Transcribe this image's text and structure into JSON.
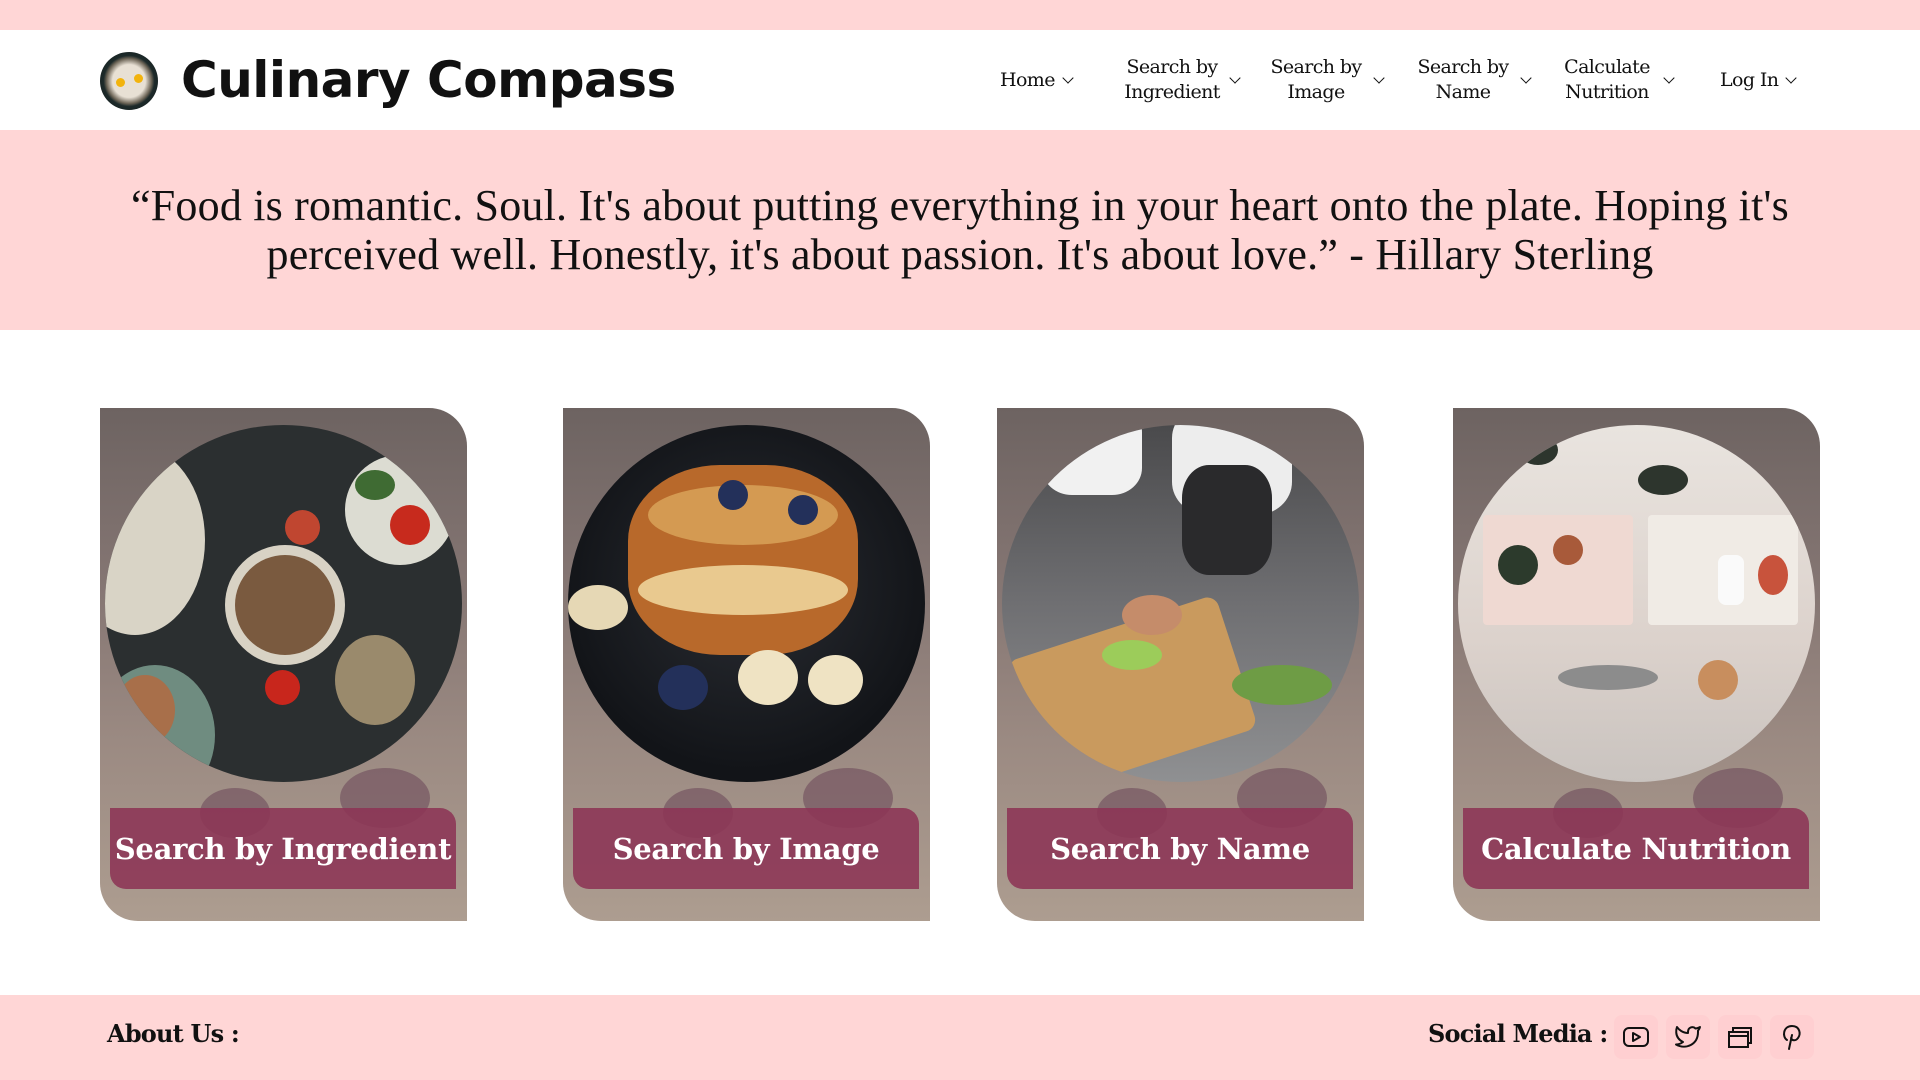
{
  "header": {
    "brand": "Culinary Compass",
    "nav": [
      {
        "label": "Home"
      },
      {
        "label": "Search by Ingredient"
      },
      {
        "label": "Search by Image"
      },
      {
        "label": "Search by Name"
      },
      {
        "label": "Calculate Nutrition"
      },
      {
        "label": "Log In"
      }
    ]
  },
  "quote": {
    "text": "“Food is romantic. Soul. It's about putting everything in your heart onto the plate. Hoping it's perceived well. Honestly, it's about passion. It's about love.” - Hillary Sterling"
  },
  "cards": [
    {
      "label": "Search by Ingredient"
    },
    {
      "label": "Search by Image"
    },
    {
      "label": "Search by Name"
    },
    {
      "label": "Calculate Nutrition"
    }
  ],
  "footer": {
    "about_label": "About Us :",
    "social_label": "Social Media :",
    "social_icons": [
      "youtube-icon",
      "twitter-icon",
      "windows-icon",
      "pinterest-icon"
    ]
  },
  "colors": {
    "pink_band": "#ffd6d6",
    "card_button": "#8c3455"
  }
}
